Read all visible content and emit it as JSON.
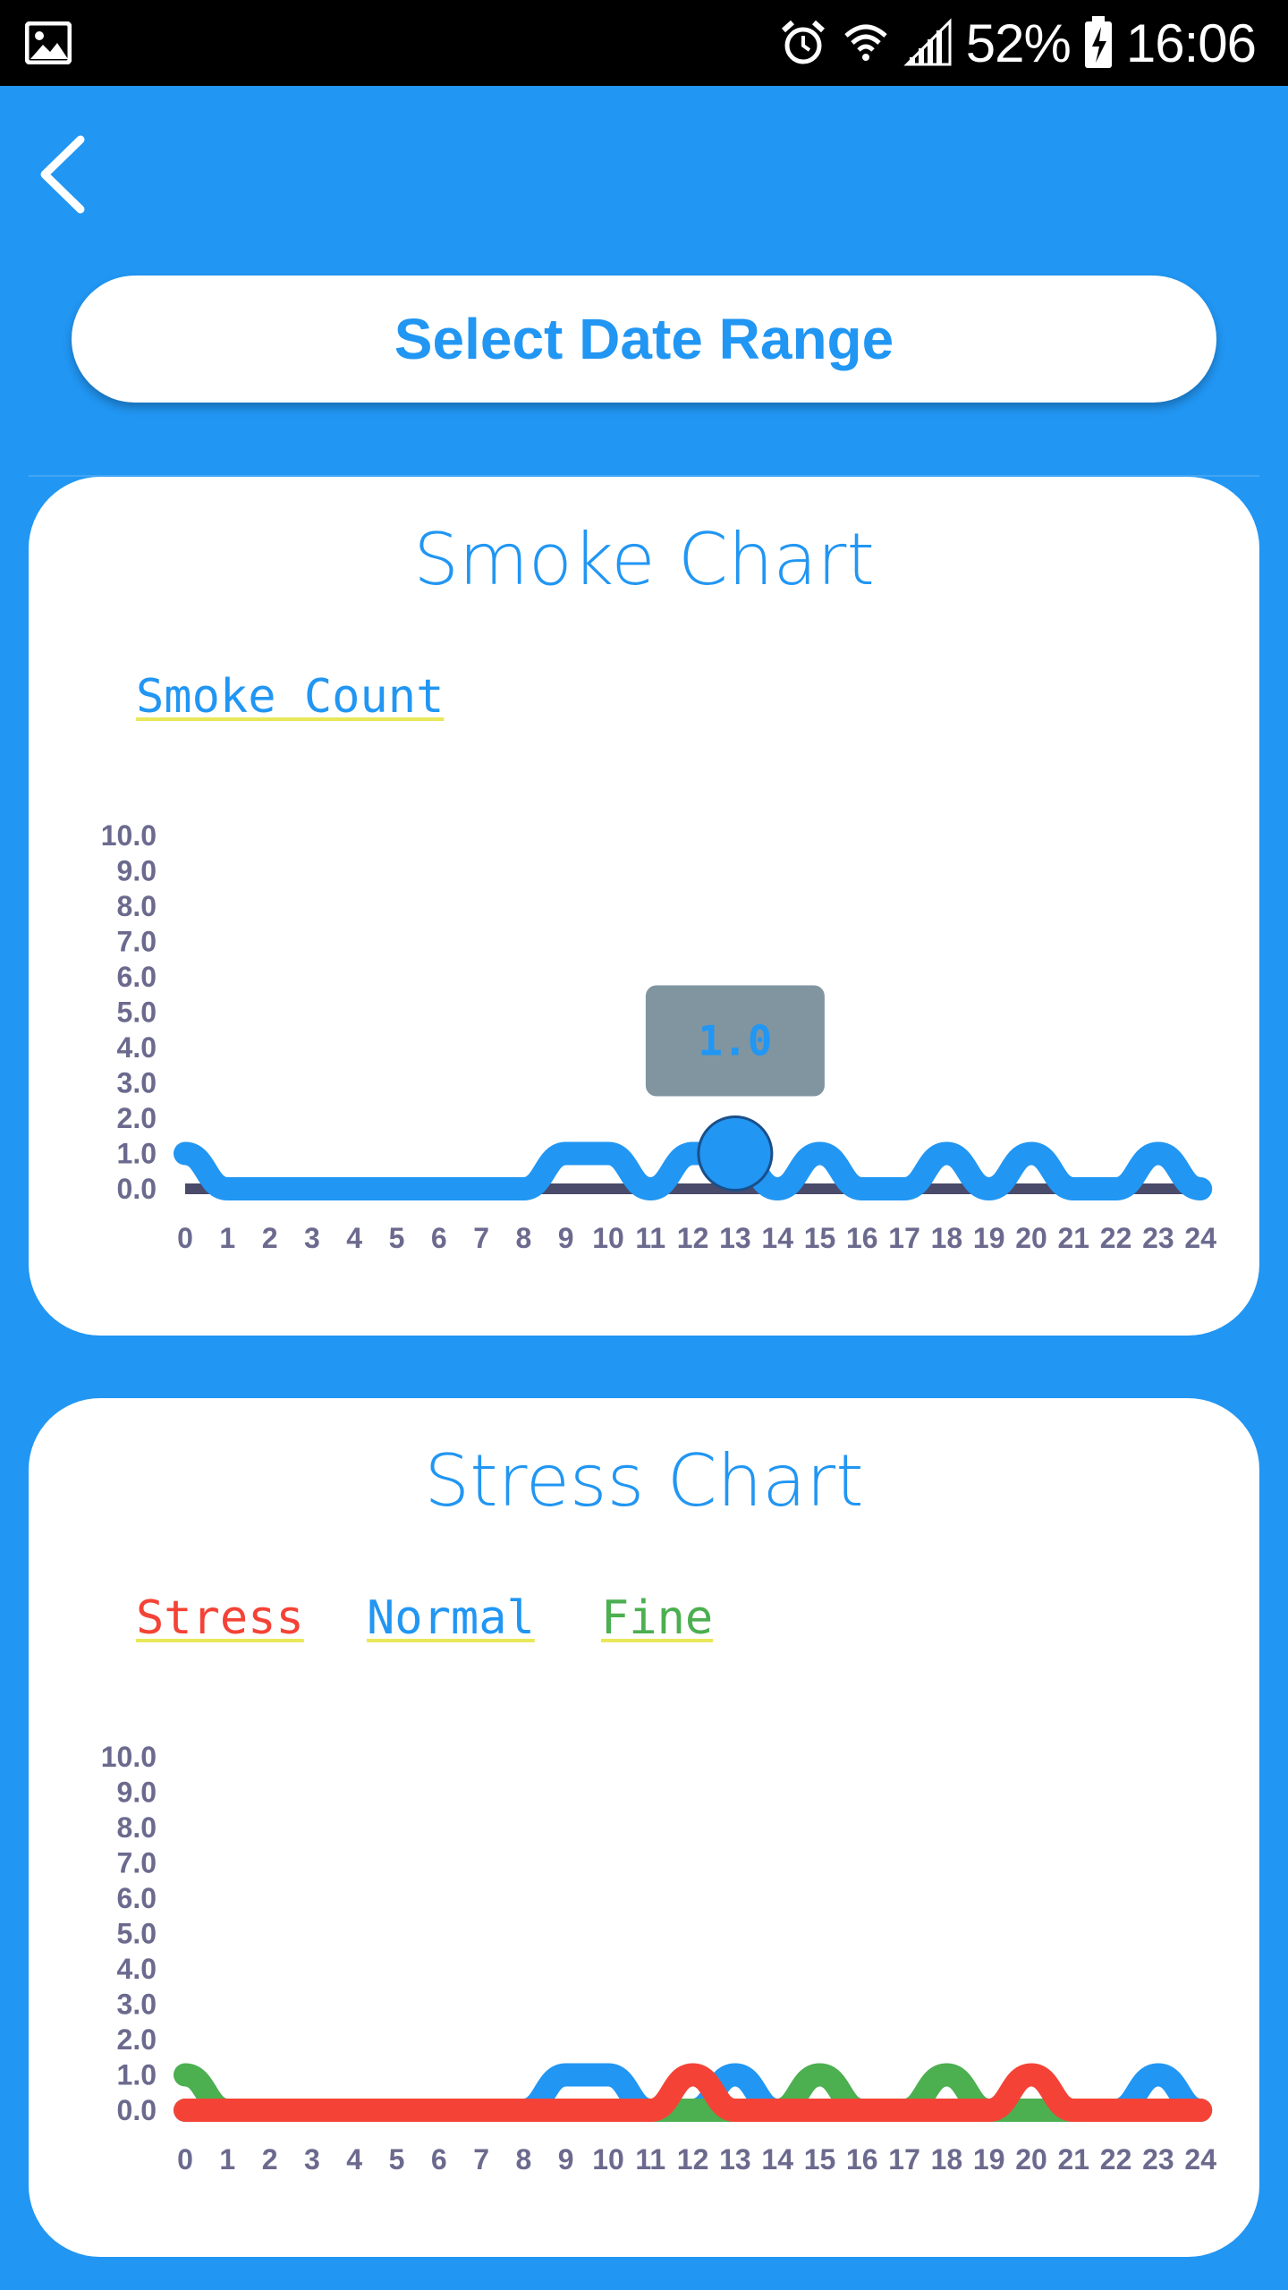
{
  "status_bar": {
    "battery": "52%",
    "time": "16:06",
    "icons": [
      "image-icon",
      "alarm-icon",
      "wifi-icon",
      "signal-icon",
      "battery-charging-icon"
    ]
  },
  "nav": {
    "back_icon": "chevron-left-icon"
  },
  "date_button": {
    "label": "Select Date Range"
  },
  "colors": {
    "accent": "#2196F3",
    "stress": "#F44336",
    "normal": "#2196F3",
    "fine": "#4CAF50",
    "axis_text": "#6b6a8e",
    "baseline": "#4a4a6a",
    "tooltip_bg": "#8095a0"
  },
  "smoke_card": {
    "title": "Smoke Chart",
    "legend": "Smoke Count",
    "tooltip": "1.0"
  },
  "stress_card": {
    "title": "Stress Chart",
    "legend": {
      "stress": "Stress",
      "normal": "Normal",
      "fine": "Fine"
    }
  },
  "chart_data": [
    {
      "type": "line",
      "title": "Smoke Chart",
      "x": [
        0,
        1,
        2,
        3,
        4,
        5,
        6,
        7,
        8,
        9,
        10,
        11,
        12,
        13,
        14,
        15,
        16,
        17,
        18,
        19,
        20,
        21,
        22,
        23,
        24
      ],
      "y_ticks": [
        "0.0",
        "1.0",
        "2.0",
        "3.0",
        "4.0",
        "5.0",
        "6.0",
        "7.0",
        "8.0",
        "9.0",
        "10.0"
      ],
      "ylim": [
        0,
        10
      ],
      "series": [
        {
          "name": "Smoke Count",
          "values": [
            1,
            0,
            0,
            0,
            0,
            0,
            0,
            0,
            0,
            1,
            1,
            0,
            1,
            1,
            0,
            1,
            0,
            0,
            1,
            0,
            1,
            0,
            0,
            1,
            0
          ]
        }
      ],
      "highlight": {
        "x": 13,
        "y": 1.0,
        "label": "1.0"
      }
    },
    {
      "type": "line",
      "title": "Stress Chart",
      "x": [
        0,
        1,
        2,
        3,
        4,
        5,
        6,
        7,
        8,
        9,
        10,
        11,
        12,
        13,
        14,
        15,
        16,
        17,
        18,
        19,
        20,
        21,
        22,
        23,
        24
      ],
      "y_ticks": [
        "0.0",
        "1.0",
        "2.0",
        "3.0",
        "4.0",
        "5.0",
        "6.0",
        "7.0",
        "8.0",
        "9.0",
        "10.0"
      ],
      "ylim": [
        0,
        10
      ],
      "series": [
        {
          "name": "Normal",
          "values": [
            0,
            0,
            0,
            0,
            0,
            0,
            0,
            0,
            0,
            1,
            1,
            0,
            0,
            1,
            0,
            0,
            0,
            0,
            0,
            0,
            0,
            0,
            0,
            1,
            0
          ]
        },
        {
          "name": "Fine",
          "values": [
            1,
            0,
            0,
            0,
            0,
            0,
            0,
            0,
            0,
            0,
            0,
            0,
            0,
            0,
            0,
            1,
            0,
            0,
            1,
            0,
            0,
            0,
            0,
            0,
            0
          ]
        },
        {
          "name": "Stress",
          "values": [
            0,
            0,
            0,
            0,
            0,
            0,
            0,
            0,
            0,
            0,
            0,
            0,
            1,
            0,
            0,
            0,
            0,
            0,
            0,
            0,
            1,
            0,
            0,
            0,
            0
          ]
        }
      ]
    }
  ]
}
